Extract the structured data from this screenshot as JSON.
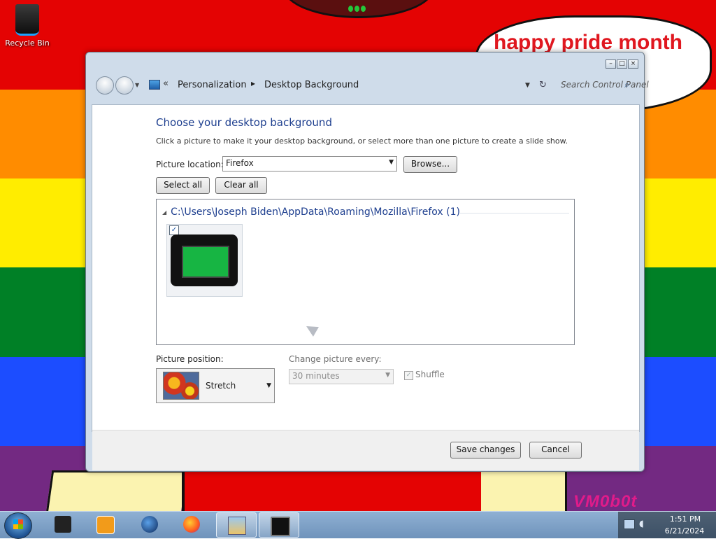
{
  "desktop": {
    "recycle_bin_label": "Recycle Bin",
    "speech_bubble_text": "happy pride month",
    "watermark_text": "VM0b0t"
  },
  "window": {
    "nav": {
      "breadcrumb": [
        "Personalization",
        "Desktop Background"
      ],
      "search_placeholder": "Search Control Panel"
    },
    "content": {
      "title": "Choose your desktop background",
      "subtitle": "Click a picture to make it your desktop background, or select more than one picture to create a slide show.",
      "picture_location_label": "Picture location:",
      "picture_location_value": "Firefox",
      "browse_button": "Browse...",
      "select_all_button": "Select all",
      "clear_all_button": "Clear all",
      "group_header": "C:\\Users\\Joseph Biden\\AppData\\Roaming\\Mozilla\\Firefox (1)",
      "thumbnail_checked": true,
      "picture_position_label": "Picture position:",
      "picture_position_value": "Stretch",
      "change_picture_label": "Change picture every:",
      "change_picture_value": "30 minutes",
      "shuffle_label": "Shuffle",
      "shuffle_checked": true
    },
    "footer": {
      "save_button": "Save changes",
      "cancel_button": "Cancel"
    }
  },
  "taskbar": {
    "items": [
      "server-icon",
      "media-player-icon",
      "globe-icon",
      "firefox-icon",
      "control-panel-icon",
      "monitor-icon"
    ],
    "clock_time": "1:51 PM",
    "clock_date": "6/21/2024"
  }
}
